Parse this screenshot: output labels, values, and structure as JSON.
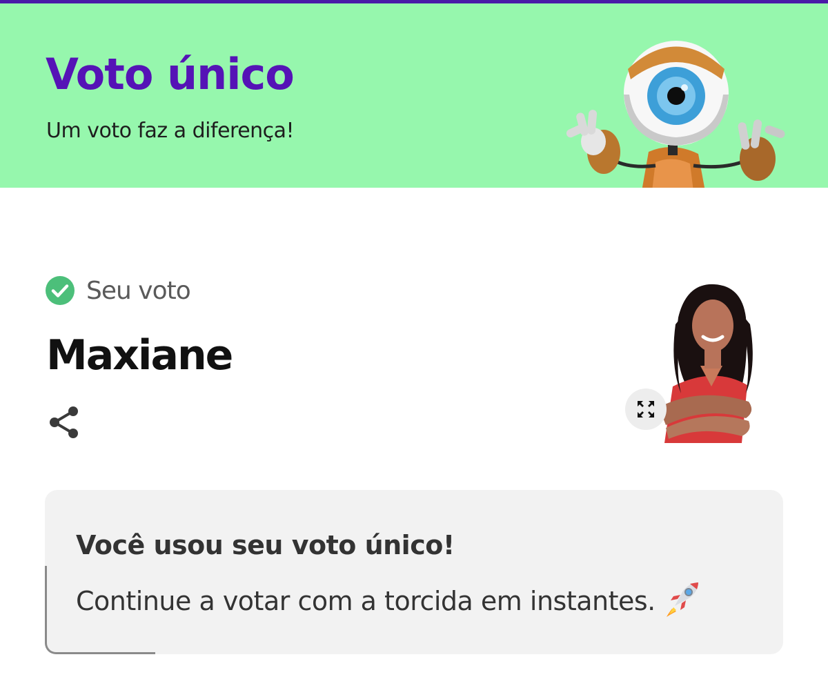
{
  "header": {
    "title": "Voto único",
    "subtitle": "Um voto faz a diferença!",
    "mascot": "big-brother-eye-robot-mascot"
  },
  "vote": {
    "label": "Seu voto",
    "candidate_name": "Maxiane",
    "icons": {
      "status": "check-circle-icon",
      "share": "share-icon",
      "expand": "expand-icon"
    },
    "photo": "candidate-photo"
  },
  "notice": {
    "title": "Você usou seu voto único!",
    "message": "Continue a votar com a torcida em instantes.",
    "icon": "rocket-icon"
  },
  "colors": {
    "brand_purple": "#5513b6",
    "banner_green": "#96f7ad",
    "check_green": "#4cbf7a",
    "card_gray": "#f2f2f2"
  }
}
